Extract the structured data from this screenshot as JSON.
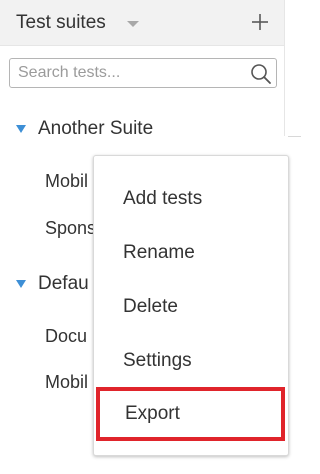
{
  "header": {
    "title": "Test suites",
    "add_icon": "plus-icon",
    "dropdown_icon": "caret-down-icon"
  },
  "search": {
    "placeholder": "Search tests...",
    "value": "",
    "icon": "search-icon"
  },
  "tree": {
    "suites": [
      {
        "label": "Another Suite",
        "expanded": true,
        "items": [
          {
            "label": "Mobil"
          },
          {
            "label": "Spons"
          }
        ]
      },
      {
        "label": "Defau",
        "expanded": true,
        "items": [
          {
            "label": "Docu"
          },
          {
            "label": "Mobil"
          }
        ]
      }
    ]
  },
  "context_menu": {
    "items": [
      {
        "label": "Add tests"
      },
      {
        "label": "Rename"
      },
      {
        "label": "Delete"
      },
      {
        "label": "Settings"
      },
      {
        "label": "Export",
        "highlighted": true
      }
    ],
    "highlight_color": "#e0242b"
  },
  "colors": {
    "accent": "#3d8fd6",
    "header_bg": "#f2f2f2",
    "text": "#333333"
  }
}
